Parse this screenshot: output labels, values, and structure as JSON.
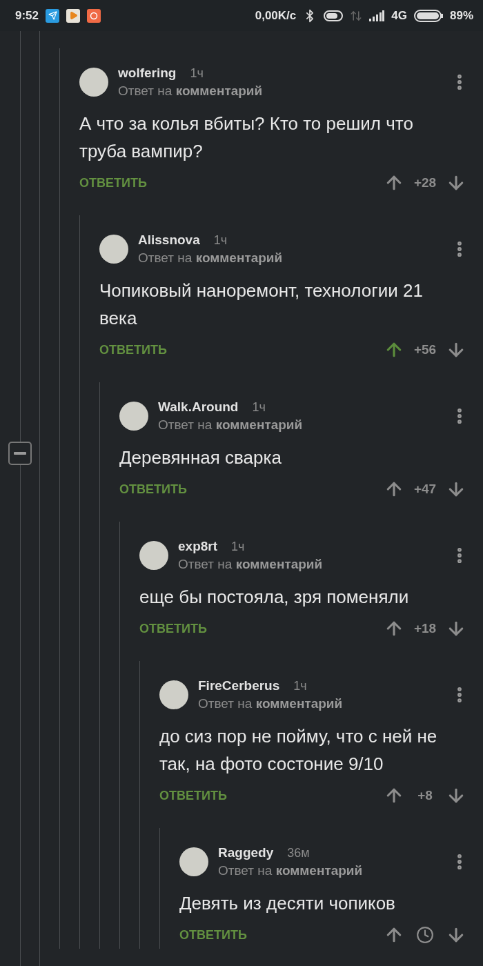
{
  "status_bar": {
    "time": "9:52",
    "speed": "0,00K/с",
    "network": "4G",
    "battery": "89%"
  },
  "thread": [
    {
      "author": "wolfering",
      "time": "1ч",
      "reply_to": "Ответ на **комментарий**",
      "text": "А что за колья вбиты? Кто то решил что труба вампир?",
      "reply": "ОТВЕТИТЬ",
      "upvoted": false,
      "kind": "scored",
      "score": "+28",
      "children": [
        {
          "author": "Alissnova",
          "time": "1ч",
          "reply_to": "Ответ на **комментарий**",
          "text": "Чопиковый наноремонт, технологии 21 века",
          "reply": "ОТВЕТИТЬ",
          "upvoted": true,
          "kind": "scored",
          "score": "+56",
          "children": [
            {
              "author": "Walk.Around",
              "time": "1ч",
              "reply_to": "Ответ на **комментарий**",
              "text": "Деревянная сварка",
              "reply": "ОТВЕТИТЬ",
              "upvoted": false,
              "kind": "scored",
              "score": "+47",
              "children": [
                {
                  "author": "exp8rt",
                  "time": "1ч",
                  "reply_to": "Ответ на **комментарий**",
                  "text": "еще бы постояла, зря поменяли",
                  "reply": "ОТВЕТИТЬ",
                  "upvoted": false,
                  "kind": "scored",
                  "score": "+18",
                  "children": [
                    {
                      "author": "FireCerberus",
                      "time": "1ч",
                      "reply_to": "Ответ на **комментарий**",
                      "text": "до сиз пор не пойму, что с ней не так, на фото состоние 9/10",
                      "reply": "ОТВЕТИТЬ",
                      "upvoted": false,
                      "kind": "scored",
                      "score": "+8",
                      "children": [
                        {
                          "author": "Raggedy",
                          "time": "36м",
                          "reply_to": "Ответ на **комментарий**",
                          "text": "Девять из десяти чопиков",
                          "reply": "ОТВЕТИТЬ",
                          "upvoted": false,
                          "kind": "pending"
                        }
                      ]
                    }
                  ]
                }
              ]
            }
          ]
        }
      ]
    }
  ]
}
